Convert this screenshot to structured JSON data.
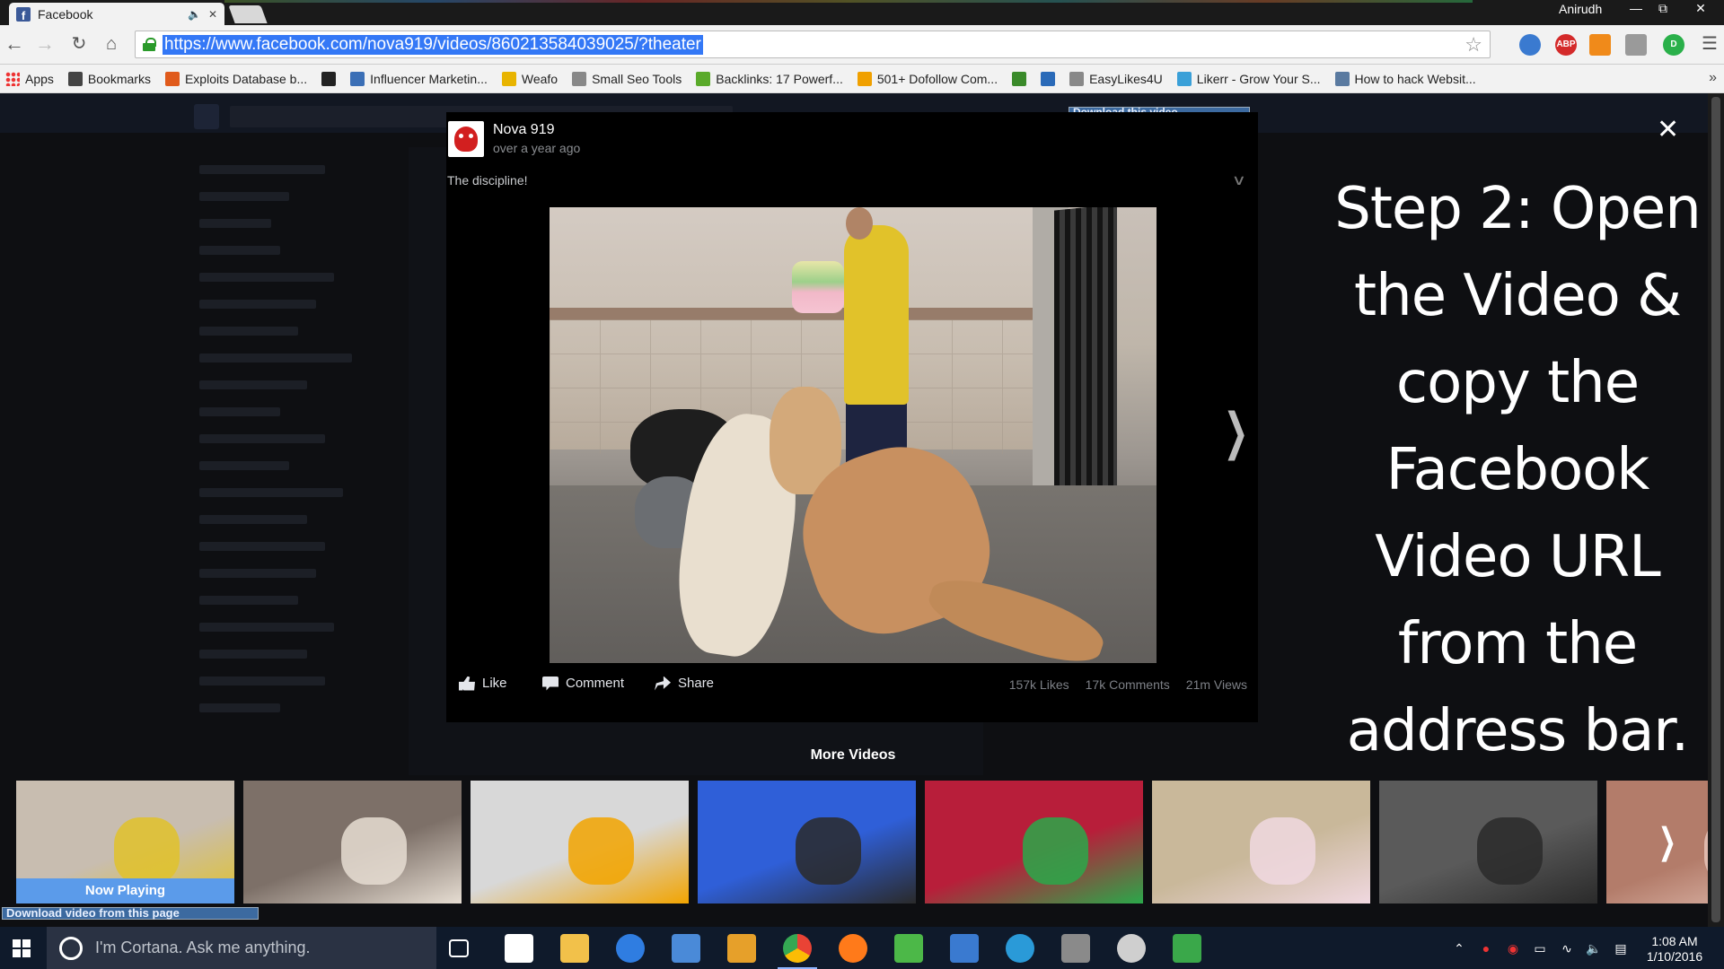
{
  "browser": {
    "tab_title": "Facebook",
    "user_name": "Anirudh",
    "url": "https://www.facebook.com/nova919/videos/860213584039025/?theater",
    "bookmarks": [
      {
        "label": "Apps",
        "icon": "apps-grid-icon",
        "color": "#e33333"
      },
      {
        "label": "Bookmarks",
        "icon": "star-icon",
        "color": "#444444"
      },
      {
        "label": "Exploits Database b...",
        "icon": "bug-icon",
        "color": "#e05a1b"
      },
      {
        "label": "",
        "icon": "n-icon",
        "color": "#222222"
      },
      {
        "label": "Influencer Marketin...",
        "icon": "bm-icon",
        "color": "#3b6fb6"
      },
      {
        "label": "Weafo",
        "icon": "triangle-icon",
        "color": "#e8b400"
      },
      {
        "label": "Small Seo Tools",
        "icon": "page-icon",
        "color": "#888888"
      },
      {
        "label": "Backlinks: 17 Powerf...",
        "icon": "backlinks-icon",
        "color": "#5aaa2a"
      },
      {
        "label": "501+ Dofollow Com...",
        "icon": "t-icon",
        "color": "#f0a000"
      },
      {
        "label": "",
        "icon": "android-icon",
        "color": "#3a8a2a"
      },
      {
        "label": "",
        "icon": "swap-icon",
        "color": "#2a6ab8"
      },
      {
        "label": "EasyLikes4U",
        "icon": "page-icon",
        "color": "#888888"
      },
      {
        "label": "Likerr - Grow Your S...",
        "icon": "refresh-icon",
        "color": "#3aa0d8"
      },
      {
        "label": "How to hack Websit...",
        "icon": "image-icon",
        "color": "#5a7aa0"
      }
    ]
  },
  "download_buttons": {
    "top": "Download this video",
    "bottom": "Download video from this page"
  },
  "post": {
    "page_name": "Nova 919",
    "time": "over a year ago",
    "caption": "The discipline!",
    "actions": {
      "like": "Like",
      "comment": "Comment",
      "share": "Share"
    },
    "stats": {
      "likes": "157k Likes",
      "comments": "17k Comments",
      "views": "21m Views"
    }
  },
  "more_videos": {
    "title": "More Videos",
    "now_playing": "Now Playing",
    "thumbnails": [
      {
        "scene": "dogs-feeding",
        "colors": [
          "#c8bdb0",
          "#e1c22a"
        ],
        "now_playing": true
      },
      {
        "scene": "table-tea",
        "colors": [
          "#7d7068",
          "#e6ddd2"
        ],
        "now_playing": false
      },
      {
        "scene": "truck-barrier",
        "colors": [
          "#d8d8d8",
          "#f2a400"
        ],
        "now_playing": false
      },
      {
        "scene": "blue-sky-pole",
        "colors": [
          "#2f5fd8",
          "#2a2a2a"
        ],
        "now_playing": false
      },
      {
        "scene": "boy-singing",
        "colors": [
          "#b81e3a",
          "#2aa84a"
        ],
        "now_playing": false
      },
      {
        "scene": "babies-sofa",
        "colors": [
          "#c9b89a",
          "#f0d8e0"
        ],
        "now_playing": false
      },
      {
        "scene": "dark-corridor",
        "colors": [
          "#5a5a5a",
          "#2a2a2a"
        ],
        "now_playing": false
      },
      {
        "scene": "woman-pink",
        "colors": [
          "#b37c6a",
          "#e6c4b8"
        ],
        "now_playing": false
      }
    ]
  },
  "overlay": {
    "lines": [
      "Step 2: Open",
      "the Video &",
      "copy the",
      "Facebook",
      "Video URL",
      "from the",
      "address bar."
    ]
  },
  "taskbar": {
    "cortana_placeholder": "I'm Cortana. Ask me anything.",
    "time": "1:08 AM",
    "date": "1/10/2016",
    "apps": [
      {
        "name": "task-view",
        "color": "#0f1a2b"
      },
      {
        "name": "store",
        "color": "#ffffff"
      },
      {
        "name": "file-explorer",
        "color": "#f2c14a"
      },
      {
        "name": "edge",
        "color": "#2f7de1"
      },
      {
        "name": "remote-desktop",
        "color": "#4a8ad8"
      },
      {
        "name": "paint",
        "color": "#e6a02a"
      },
      {
        "name": "chrome",
        "color": "#e94335"
      },
      {
        "name": "firefox",
        "color": "#ff7a1a"
      },
      {
        "name": "utorrent",
        "color": "#4cb848"
      },
      {
        "name": "network-app",
        "color": "#3a7ad0"
      },
      {
        "name": "circle-app",
        "color": "#2a9ad8"
      },
      {
        "name": "mmc",
        "color": "#8a8a8a"
      },
      {
        "name": "settings",
        "color": "#cfcfcf"
      },
      {
        "name": "utorrent-green",
        "color": "#3aa84a"
      }
    ]
  }
}
